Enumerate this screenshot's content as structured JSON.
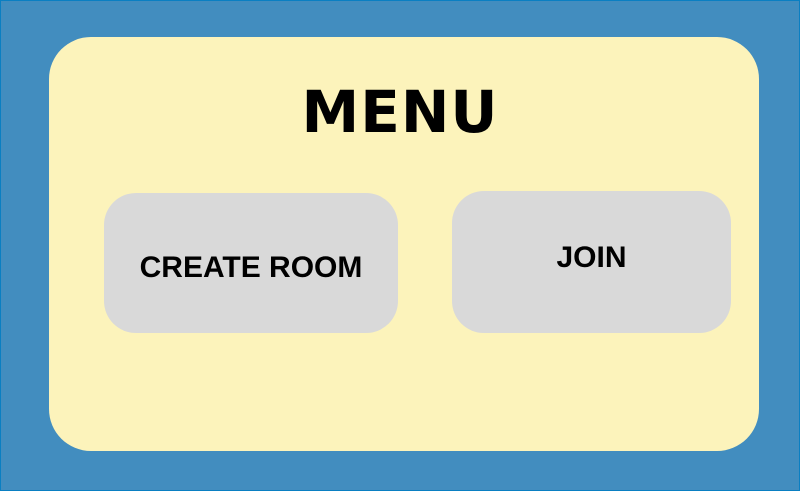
{
  "menu": {
    "title": "MENU",
    "create_room_label": "CREATE ROOM",
    "join_label": "JOIN"
  },
  "colors": {
    "background": "#428dbf",
    "panel": "#fcf3bb",
    "button": "#d9d9d9"
  }
}
